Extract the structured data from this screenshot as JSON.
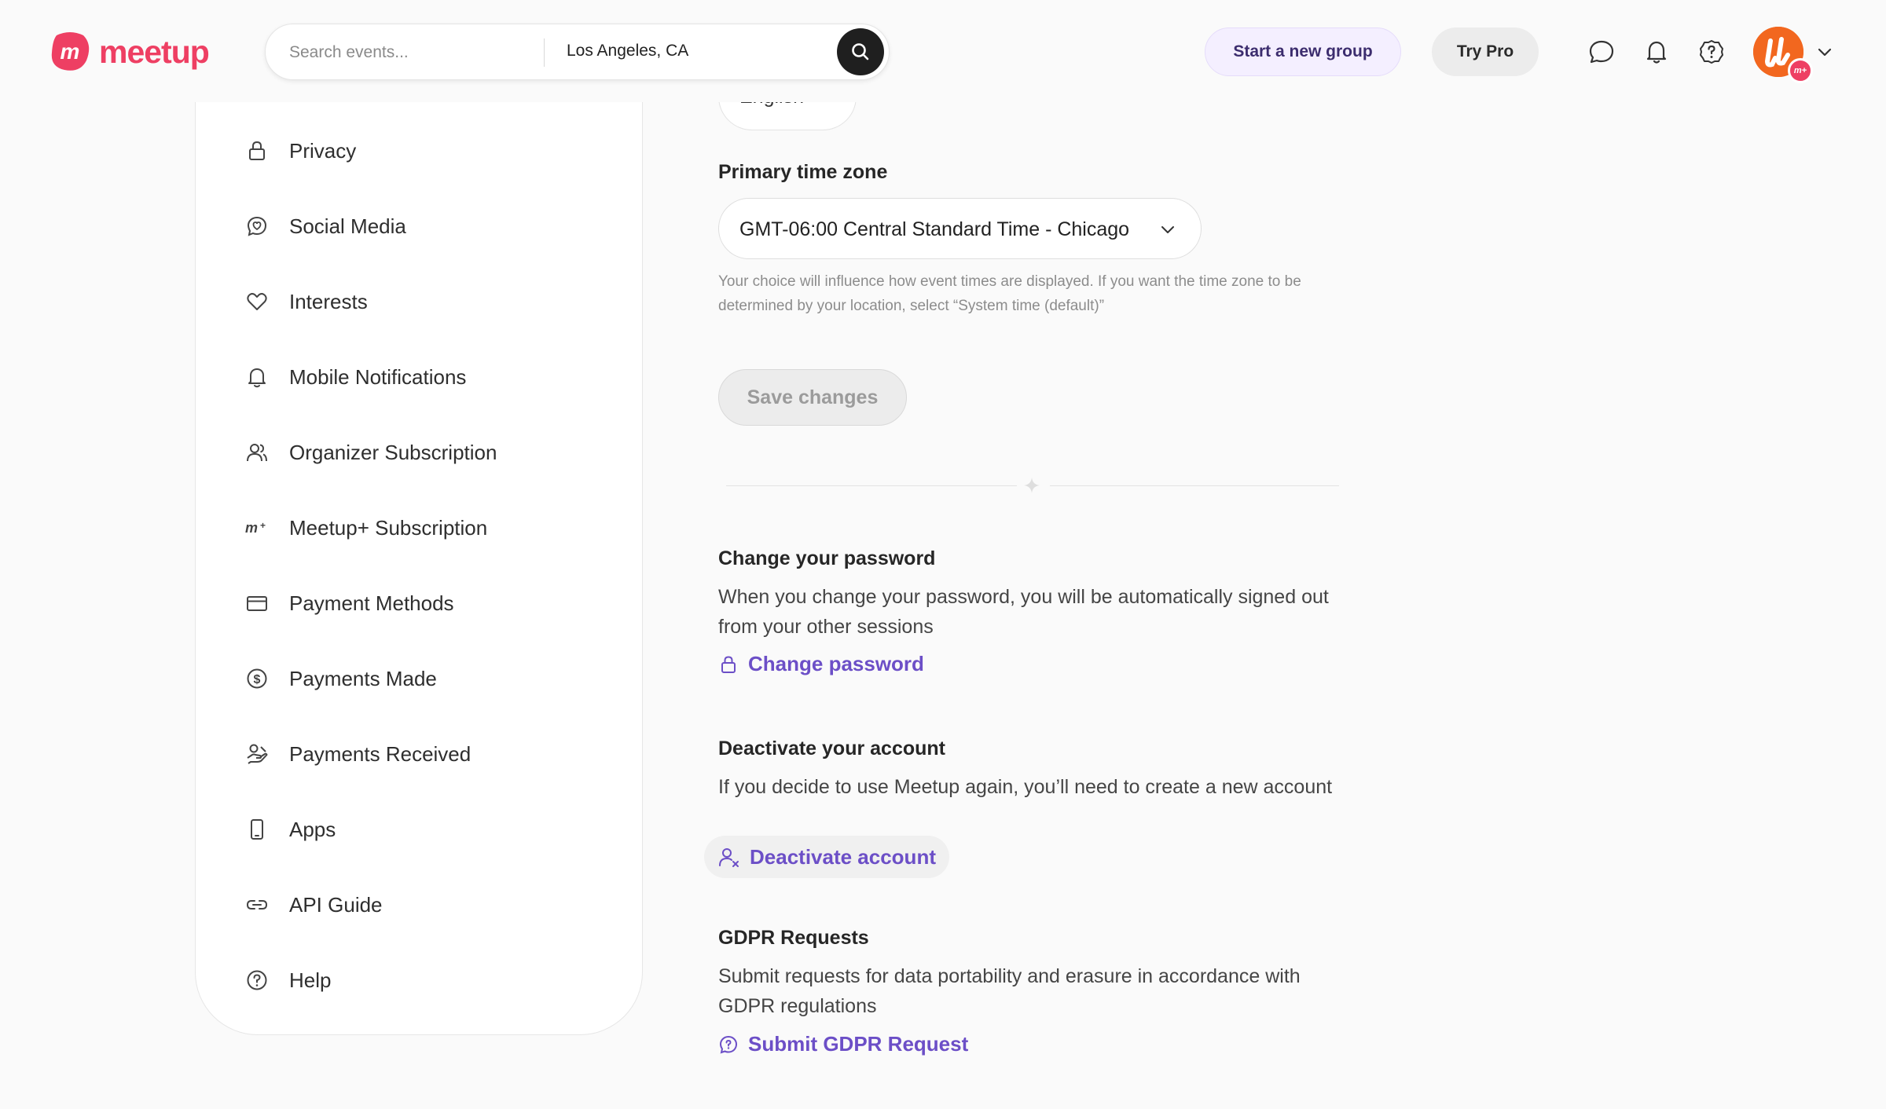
{
  "header": {
    "logo_text": "meetup",
    "search_placeholder": "Search events...",
    "location": "Los Angeles, CA",
    "start_group_label": "Start a new group",
    "try_pro_label": "Try Pro",
    "avatar_badge": "m+",
    "icons": [
      "search-icon",
      "chat-icon",
      "bell-icon",
      "help-icon",
      "chevron-down-icon"
    ]
  },
  "sidebar": {
    "items": [
      {
        "label": "Privacy",
        "icon": "lock-icon"
      },
      {
        "label": "Social Media",
        "icon": "social-media-icon"
      },
      {
        "label": "Interests",
        "icon": "heart-icon"
      },
      {
        "label": "Mobile Notifications",
        "icon": "bell-icon"
      },
      {
        "label": "Organizer Subscription",
        "icon": "users-icon"
      },
      {
        "label": "Meetup+ Subscription",
        "icon": "meetup-plus-icon"
      },
      {
        "label": "Payment Methods",
        "icon": "credit-card-icon"
      },
      {
        "label": "Payments Made",
        "icon": "dollar-circle-icon"
      },
      {
        "label": "Payments Received",
        "icon": "hand-money-icon"
      },
      {
        "label": "Apps",
        "icon": "phone-icon"
      },
      {
        "label": "API Guide",
        "icon": "link-icon"
      },
      {
        "label": "Help",
        "icon": "help-icon"
      }
    ]
  },
  "main": {
    "language_value": "English",
    "timezone": {
      "label": "Primary time zone",
      "value": "GMT-06:00 Central Standard Time - Chicago",
      "hint": "Your choice will influence how event times are displayed. If you want the time zone to be determined by your location, select “System time (default)”"
    },
    "save_label": "Save changes",
    "password": {
      "title": "Change your password",
      "description": "When you change your password, you will be automatically signed out from your other sessions",
      "action": "Change password"
    },
    "deactivate": {
      "title": "Deactivate your account",
      "description": "If you decide to use Meetup again, you’ll need to create a new account",
      "action": "Deactivate account"
    },
    "gdpr": {
      "title": "GDPR Requests",
      "description": "Submit requests for data portability and erasure in accordance with GDPR regulations",
      "action": "Submit GDPR Request"
    }
  },
  "colors": {
    "brand": "#ee3f63",
    "accent": "#6c4fc7",
    "avatar": "#f2671f"
  }
}
